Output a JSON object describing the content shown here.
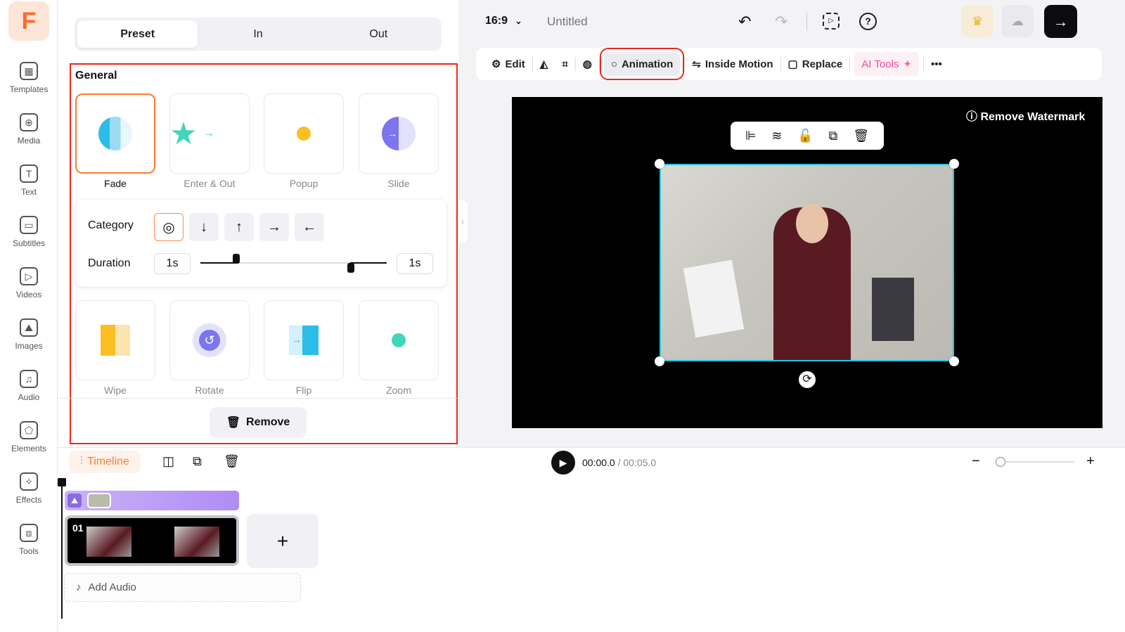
{
  "sidebar": {
    "logo": "F",
    "items": [
      {
        "label": "Templates",
        "icon": "templates-icon"
      },
      {
        "label": "Media",
        "icon": "media-icon"
      },
      {
        "label": "Text",
        "icon": "text-icon"
      },
      {
        "label": "Subtitles",
        "icon": "subtitles-icon"
      },
      {
        "label": "Videos",
        "icon": "videos-icon"
      },
      {
        "label": "Images",
        "icon": "images-icon"
      },
      {
        "label": "Audio",
        "icon": "audio-icon"
      },
      {
        "label": "Elements",
        "icon": "elements-icon"
      },
      {
        "label": "Effects",
        "icon": "effects-icon"
      },
      {
        "label": "Tools",
        "icon": "tools-icon"
      }
    ]
  },
  "panel": {
    "tabs": [
      "Preset",
      "In",
      "Out"
    ],
    "section": "General",
    "presets_top": [
      "Fade",
      "Enter & Out",
      "Popup",
      "Slide"
    ],
    "presets_bottom": [
      "Wipe",
      "Rotate",
      "Flip",
      "Zoom"
    ],
    "category_label": "Category",
    "category_options": [
      "◎",
      "↓",
      "↑",
      "→",
      "←"
    ],
    "duration_label": "Duration",
    "duration_in": "1s",
    "duration_out": "1s",
    "remove": "Remove"
  },
  "header": {
    "ratio": "16:9",
    "title": "Untitled"
  },
  "toolbar": {
    "edit": "Edit",
    "animation": "Animation",
    "inside_motion": "Inside Motion",
    "replace": "Replace",
    "ai_tools": "AI Tools",
    "more": "•••"
  },
  "canvas": {
    "watermark": "Remove Watermark"
  },
  "timeline": {
    "label": "Timeline",
    "current": "00:00.0",
    "total": "/ 00:05.0",
    "clip_number": "01",
    "add_audio": "Add Audio",
    "add": "+"
  },
  "colors": {
    "accent": "#ff7a2f",
    "highlight": "#f0261b",
    "selection": "#27c6dc"
  }
}
